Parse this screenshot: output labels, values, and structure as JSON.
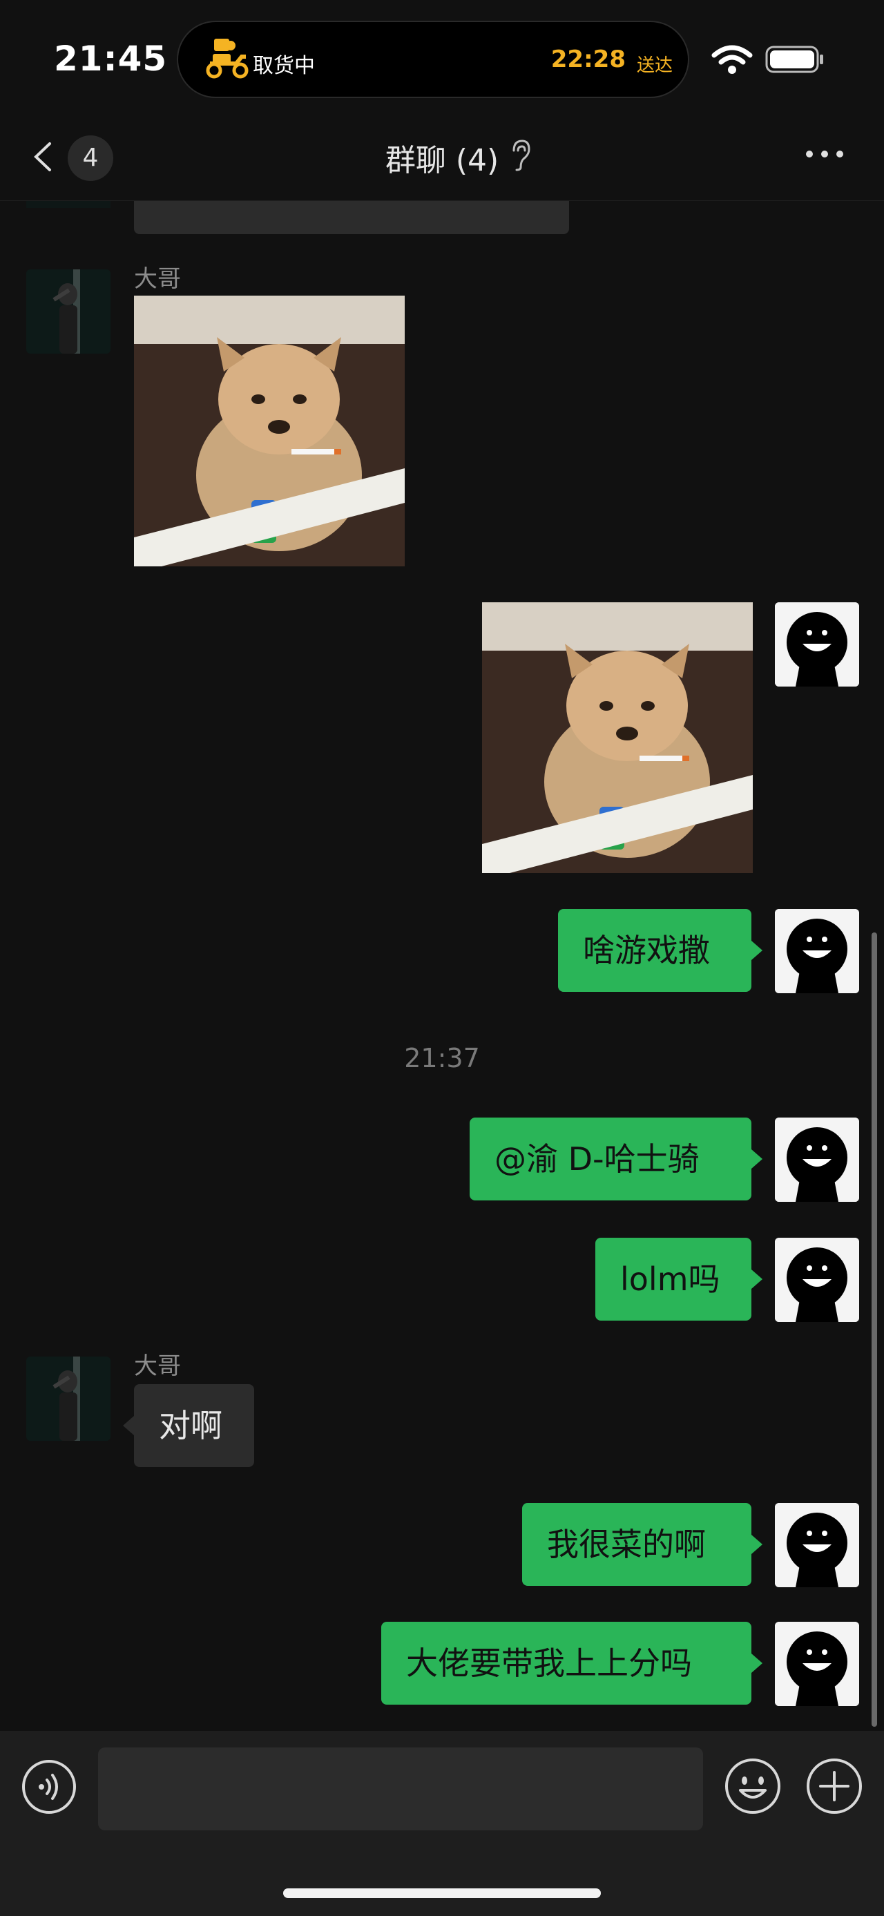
{
  "status_bar": {
    "time": "21:45",
    "live_activity": {
      "label": "取货中",
      "eta_time": "22:28",
      "eta_suffix": "送达"
    }
  },
  "nav": {
    "back_badge_count": "4",
    "title": "群聊 (4)"
  },
  "messages": [
    {
      "id": "m1",
      "from": "other",
      "sender": "大哥",
      "type": "sticker"
    },
    {
      "id": "m2",
      "from": "me",
      "type": "sticker"
    },
    {
      "id": "m3",
      "from": "me",
      "type": "text",
      "text": "啥游戏撒"
    },
    {
      "id": "m4",
      "from": "me",
      "type": "text",
      "text": "@渝 D-哈士骑"
    },
    {
      "id": "m5",
      "from": "me",
      "type": "text",
      "text": "lolm吗"
    },
    {
      "id": "m6",
      "from": "other",
      "sender": "大哥",
      "type": "text",
      "text": "对啊"
    },
    {
      "id": "m7",
      "from": "me",
      "type": "text",
      "text": "我很菜的啊"
    },
    {
      "id": "m8",
      "from": "me",
      "type": "text",
      "text": "大佬要带我上上分吗"
    }
  ],
  "timestamp_divider": "21:37",
  "colors": {
    "background": "#111111",
    "my_bubble": "#2ab558",
    "other_bubble": "#2c2c2c",
    "eta_accent": "#f5b323"
  },
  "icons": [
    "back-chevron-icon",
    "ear-icon",
    "more-icon",
    "voice-icon",
    "emoji-icon",
    "add-icon",
    "wifi-icon",
    "battery-icon",
    "scooter-icon"
  ]
}
